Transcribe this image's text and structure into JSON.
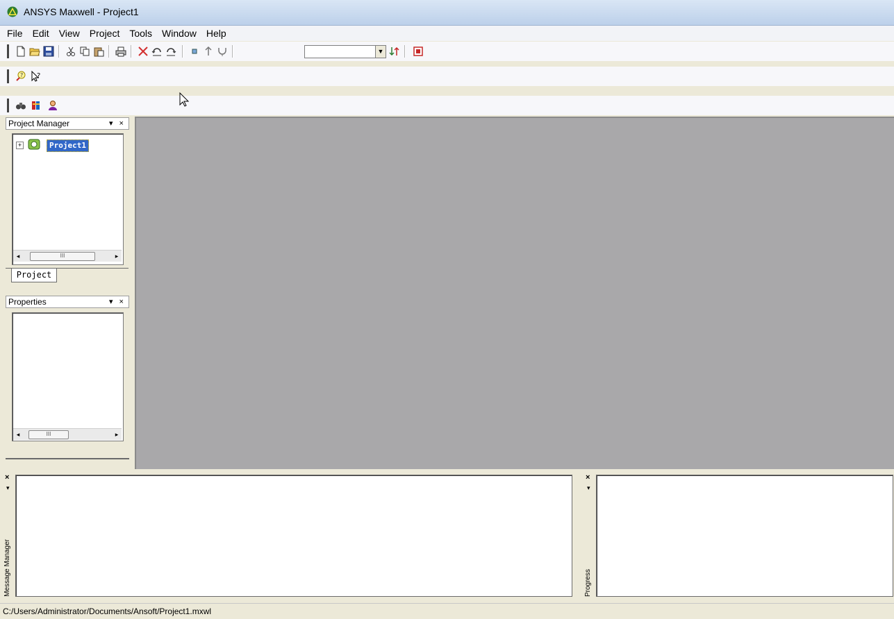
{
  "window": {
    "title": "ANSYS Maxwell - Project1"
  },
  "menu": [
    "File",
    "Edit",
    "View",
    "Project",
    "Tools",
    "Window",
    "Help"
  ],
  "project_manager": {
    "title": "Project Manager",
    "controls": "▾ ×",
    "tree_root": "Project1",
    "tab_label": "Project"
  },
  "properties": {
    "title": "Properties",
    "controls": "▾ ×"
  },
  "message_manager": {
    "label": "Message Manager"
  },
  "progress": {
    "label": "Progress"
  },
  "status_bar": {
    "path": "C:/Users/Administrator/Documents/Ansoft/Project1.mxwl"
  },
  "scrollbar_glyphs": {
    "left": "◂",
    "right": "▸",
    "grip": "III"
  },
  "colors": {
    "selection": "#3167c8",
    "workspace": "#a9a8aa",
    "titlebar": "#bcd0ea"
  }
}
